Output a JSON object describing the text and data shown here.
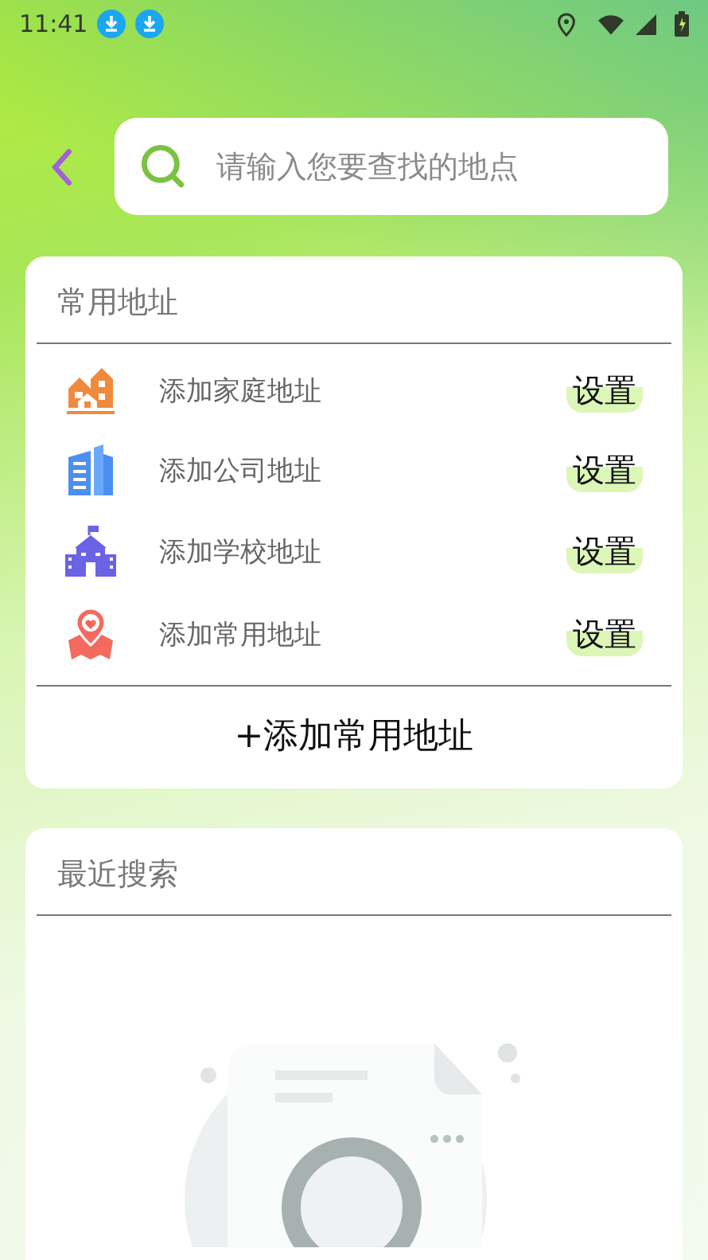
{
  "status_bar": {
    "time": "11:41"
  },
  "search": {
    "placeholder": "请输入您要查找的地点"
  },
  "common_addresses": {
    "title": "常用地址",
    "items": [
      {
        "kind": "home",
        "label": "添加家庭地址",
        "action": "设置"
      },
      {
        "kind": "office",
        "label": "添加公司地址",
        "action": "设置"
      },
      {
        "kind": "school",
        "label": "添加学校地址",
        "action": "设置"
      },
      {
        "kind": "pin",
        "label": "添加常用地址",
        "action": "设置"
      }
    ],
    "add_button": "+添加常用地址"
  },
  "recent_searches": {
    "title": "最近搜索"
  }
}
